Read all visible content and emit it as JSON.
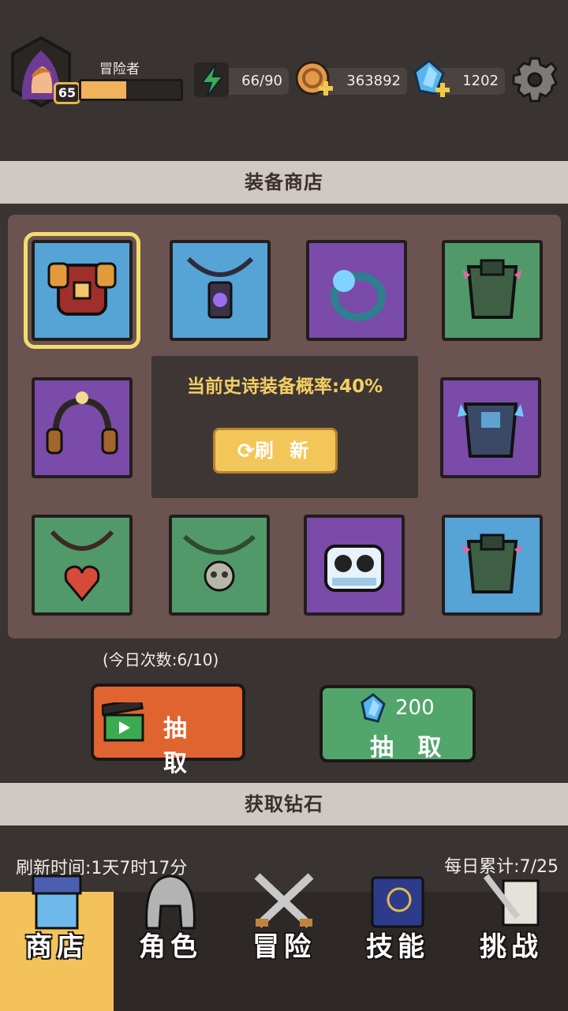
{
  "player": {
    "name": "冒险者",
    "level": "65",
    "xp_fraction": 0.45
  },
  "resources": {
    "energy": "66/90",
    "gold": "363892",
    "gems": "1202"
  },
  "icons": {
    "energy": "lightning-icon",
    "gold": "gold-coin-icon",
    "gems": "blue-gem-icon",
    "settings": "gear-icon"
  },
  "shop": {
    "title": "装备商店",
    "epic_rate": "当前史诗装备概率:40%",
    "refresh_label": "刷 新",
    "daily_count": "(今日次数:6/10)",
    "draw_label": "抽 取",
    "gem_draw_cost": "200",
    "gem_draw_label": "抽 取",
    "items": [
      {
        "name": "orange-chest-armor-icon",
        "bg": "blue",
        "selected": true
      },
      {
        "name": "purple-lantern-amulet-icon",
        "bg": "blue"
      },
      {
        "name": "blue-ring-icon",
        "bg": "purple"
      },
      {
        "name": "spiked-green-armor-icon",
        "bg": "green"
      },
      {
        "name": "headphones-icon",
        "bg": "purple"
      },
      {
        "name": "ice-crystal-armor-icon",
        "bg": "purple"
      },
      {
        "name": "red-heart-necklace-icon",
        "bg": "green"
      },
      {
        "name": "skull-tooth-necklace-icon",
        "bg": "green"
      },
      {
        "name": "ice-goggle-helmet-icon",
        "bg": "purple"
      },
      {
        "name": "spiked-green-armor-icon",
        "bg": "blue"
      }
    ]
  },
  "gems_section": {
    "title": "获取钻石",
    "refresh_time": "刷新时间:1天7时17分",
    "daily_total": "每日累计:7/25"
  },
  "nav": [
    {
      "label": "商店",
      "icon": "shop-stall-icon",
      "active": true
    },
    {
      "label": "角色",
      "icon": "helmet-icon"
    },
    {
      "label": "冒险",
      "icon": "crossed-swords-icon"
    },
    {
      "label": "技能",
      "icon": "spellbook-icon"
    },
    {
      "label": "挑战",
      "icon": "sword-scroll-icon"
    }
  ]
}
